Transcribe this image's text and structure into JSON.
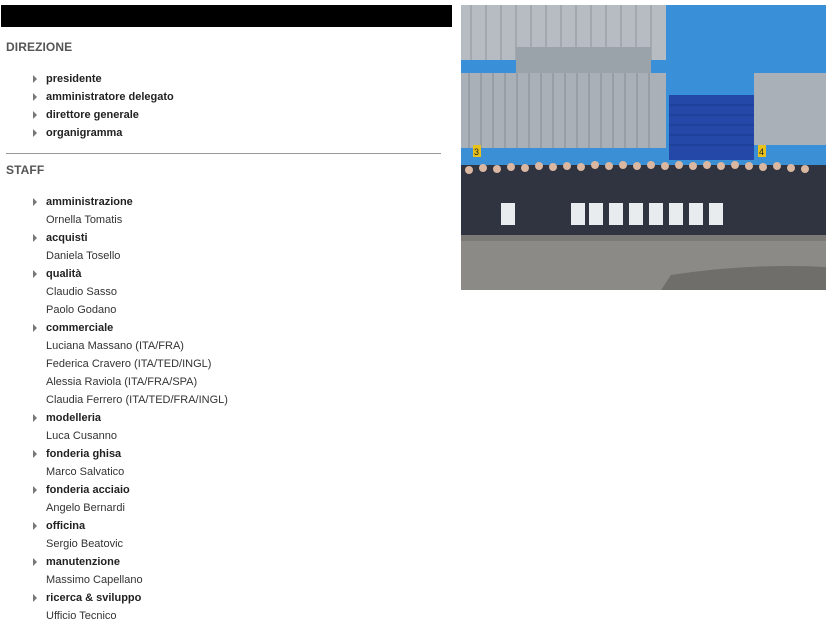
{
  "direzione": {
    "title": "DIREZIONE",
    "items": [
      "presidente",
      "amministratore delegato",
      "direttore generale",
      "organigramma"
    ]
  },
  "staff": {
    "title": "STAFF",
    "entries": [
      {
        "type": "link",
        "text": "amministrazione"
      },
      {
        "type": "name",
        "text": "Ornella Tomatis"
      },
      {
        "type": "link",
        "text": "acquisti"
      },
      {
        "type": "name",
        "text": "Daniela Tosello"
      },
      {
        "type": "link",
        "text": "qualità"
      },
      {
        "type": "name",
        "text": "Claudio Sasso"
      },
      {
        "type": "name",
        "text": "Paolo Godano"
      },
      {
        "type": "link",
        "text": "commerciale"
      },
      {
        "type": "name",
        "text": "Luciana Massano (ITA/FRA)"
      },
      {
        "type": "name",
        "text": "Federica Cravero (ITA/TED/INGL)"
      },
      {
        "type": "name",
        "text": "Alessia Raviola (ITA/FRA/SPA)"
      },
      {
        "type": "name",
        "text": "Claudia Ferrero (ITA/TED/FRA/INGL)"
      },
      {
        "type": "link",
        "text": "modelleria"
      },
      {
        "type": "name",
        "text": "Luca Cusanno"
      },
      {
        "type": "link",
        "text": "fonderia ghisa"
      },
      {
        "type": "name",
        "text": "Marco Salvatico"
      },
      {
        "type": "link",
        "text": "fonderia acciaio"
      },
      {
        "type": "name",
        "text": "Angelo Bernardi"
      },
      {
        "type": "link",
        "text": "officina"
      },
      {
        "type": "name",
        "text": "Sergio Beatovic"
      },
      {
        "type": "link",
        "text": "manutenzione"
      },
      {
        "type": "name",
        "text": "Massimo Capellano"
      },
      {
        "type": "link",
        "text": "ricerca & sviluppo"
      },
      {
        "type": "name",
        "text": "Ufficio Tecnico"
      }
    ]
  },
  "photo": {
    "door_labels": [
      "3",
      "4"
    ]
  }
}
